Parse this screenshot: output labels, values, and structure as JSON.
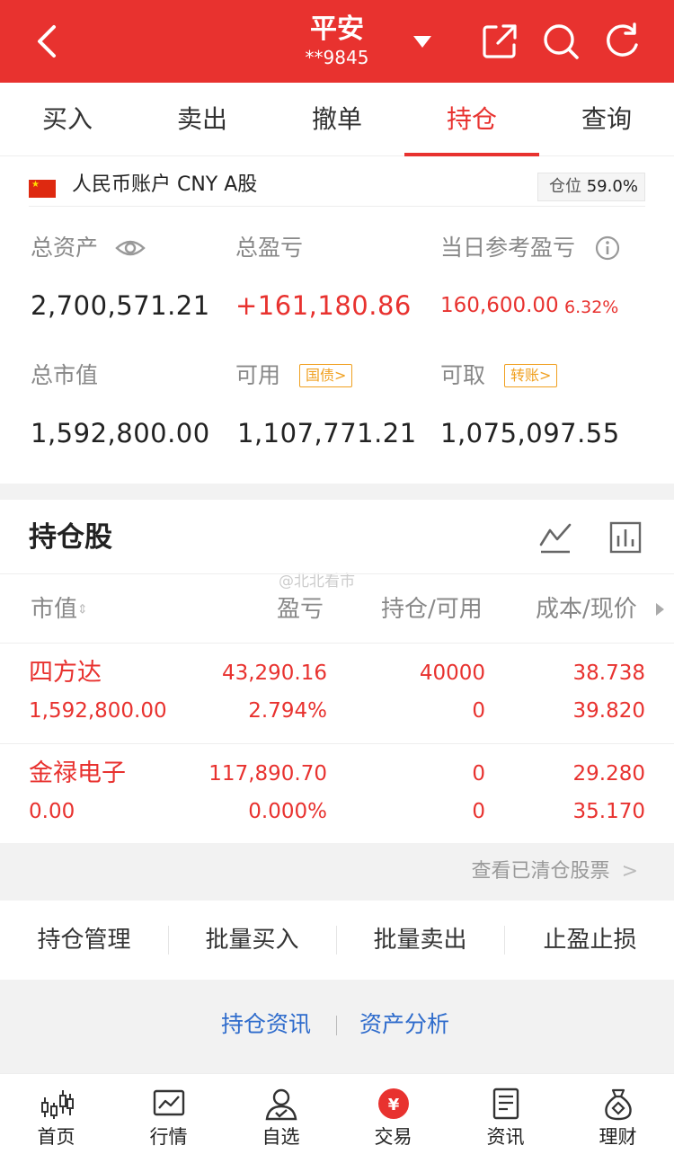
{
  "colors": {
    "brand_red": "#e8322f",
    "orange_tag": "#f0a020",
    "link_blue": "#2f6ccc",
    "muted": "#888888"
  },
  "header": {
    "title": "平安",
    "account_mask": "**9845",
    "icons": [
      "back-icon",
      "chevron-down-icon",
      "share-icon",
      "search-icon",
      "refresh-icon"
    ]
  },
  "tabs": [
    {
      "label": "买入"
    },
    {
      "label": "卖出"
    },
    {
      "label": "撤单"
    },
    {
      "label": "持仓",
      "active": true
    },
    {
      "label": "查询"
    }
  ],
  "account": {
    "label": "人民币账户 CNY A股",
    "position_label": "仓位",
    "position_value": "59.0%"
  },
  "summary": {
    "total_assets_label": "总资产",
    "total_assets": "2,700,571.21",
    "total_pnl_label": "总盈亏",
    "total_pnl": "+161,180.86",
    "daily_pnl_label": "当日参考盈亏",
    "daily_pnl": "160,600.00",
    "daily_pnl_pct": "6.32%",
    "market_value_label": "总市值",
    "market_value": "1,592,800.00",
    "available_label": "可用",
    "available_tag": "国债",
    "available": "1,107,771.21",
    "withdrawable_label": "可取",
    "withdrawable_tag": "转账",
    "withdrawable": "1,075,097.55"
  },
  "holdings": {
    "title": "持仓股",
    "watermark": "@北北看市",
    "columns": [
      "市值",
      "盈亏",
      "持仓/可用",
      "成本/现价"
    ],
    "rows": [
      {
        "name": "四方达",
        "market_value": "1,592,800.00",
        "pnl": "43,290.16",
        "pnl_pct": "2.794%",
        "position": "40000",
        "available": "0",
        "cost": "38.738",
        "price": "39.820"
      },
      {
        "name": "金禄电子",
        "market_value": "0.00",
        "pnl": "117,890.70",
        "pnl_pct": "0.000%",
        "position": "0",
        "available": "0",
        "cost": "29.280",
        "price": "35.170"
      }
    ],
    "cleared_link": "查看已清仓股票"
  },
  "actions": [
    "持仓管理",
    "批量买入",
    "批量卖出",
    "止盈止损"
  ],
  "links": [
    "持仓资讯",
    "资产分析"
  ],
  "bottom_nav": [
    {
      "label": "首页",
      "icon": "home-candlestick-icon"
    },
    {
      "label": "行情",
      "icon": "market-chart-icon"
    },
    {
      "label": "自选",
      "icon": "watchlist-user-icon"
    },
    {
      "label": "交易",
      "icon": "yuan-trade-icon",
      "active": true
    },
    {
      "label": "资讯",
      "icon": "news-doc-icon"
    },
    {
      "label": "理财",
      "icon": "money-bag-icon"
    }
  ]
}
